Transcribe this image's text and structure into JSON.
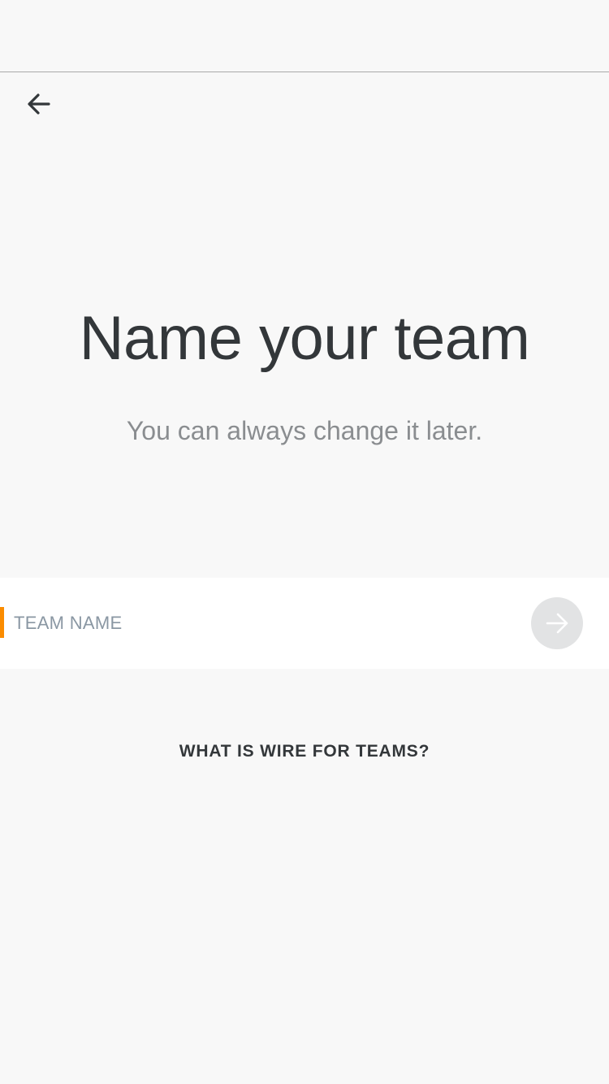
{
  "header": {
    "back_icon": "arrow-left-icon"
  },
  "main": {
    "title": "Name your team",
    "subtitle": "You can always change it later."
  },
  "team_input": {
    "placeholder": "TEAM NAME",
    "value": "",
    "submit_icon": "arrow-right-icon",
    "caret_color": "#fb8c00"
  },
  "footer": {
    "link_label": "WHAT IS WIRE FOR TEAMS?"
  }
}
